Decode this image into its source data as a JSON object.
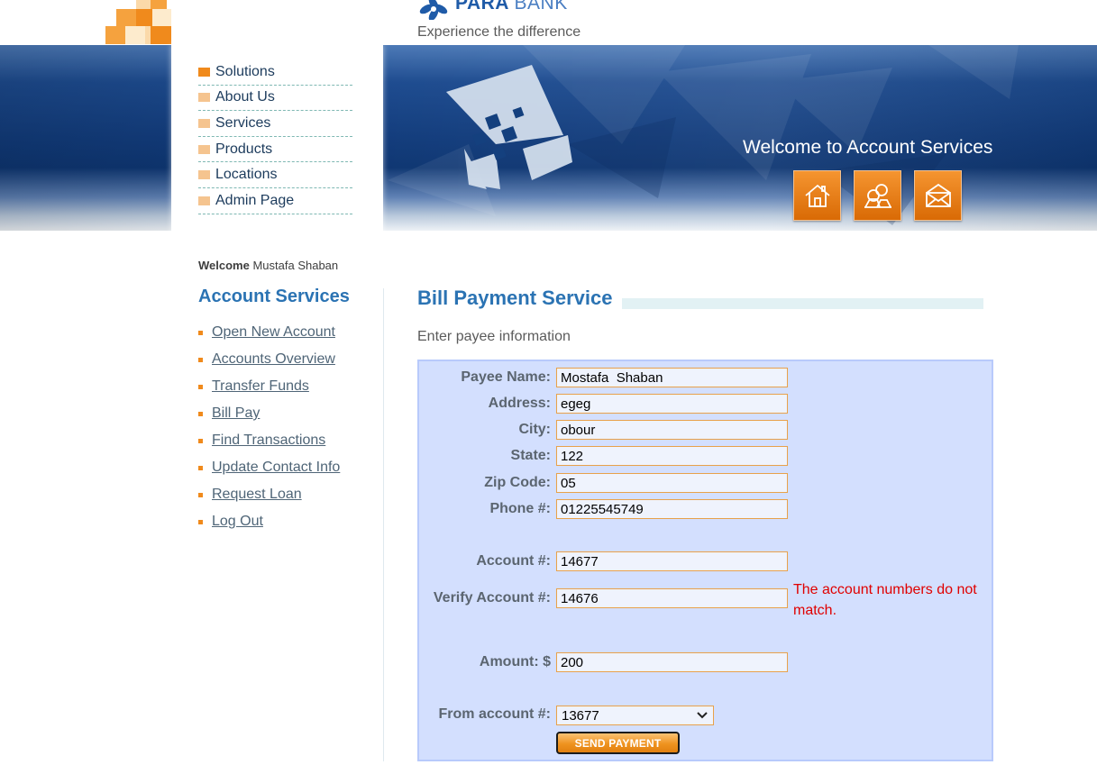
{
  "brand": {
    "name_bold": "PARA",
    "name_thin": "BANK",
    "tagline": "Experience the difference"
  },
  "banner": {
    "welcome_text": "Welcome to Account Services",
    "icons": [
      "home-icon",
      "contact-icon",
      "mail-icon"
    ]
  },
  "top_nav": {
    "items": [
      {
        "label": "Solutions"
      },
      {
        "label": "About Us"
      },
      {
        "label": "Services"
      },
      {
        "label": "Products"
      },
      {
        "label": "Locations"
      },
      {
        "label": "Admin Page"
      }
    ]
  },
  "sidebar": {
    "welcome_label": "Welcome",
    "user_name": "Mustafa Shaban",
    "heading": "Account Services",
    "links": [
      {
        "label": "Open New Account"
      },
      {
        "label": "Accounts Overview"
      },
      {
        "label": "Transfer Funds"
      },
      {
        "label": "Bill Pay"
      },
      {
        "label": "Find Transactions"
      },
      {
        "label": "Update Contact Info"
      },
      {
        "label": "Request Loan"
      },
      {
        "label": "Log Out"
      }
    ]
  },
  "main": {
    "title": "Bill Payment Service",
    "intro": "Enter payee information",
    "form": {
      "payee_name": {
        "label": "Payee Name:",
        "value": "Mostafa  Shaban"
      },
      "address": {
        "label": "Address:",
        "value": "egeg"
      },
      "city": {
        "label": "City:",
        "value": "obour"
      },
      "state": {
        "label": "State:",
        "value": "122"
      },
      "zip": {
        "label": "Zip Code:",
        "value": "05"
      },
      "phone": {
        "label": "Phone #:",
        "value": "01225545749"
      },
      "account": {
        "label": "Account #:",
        "value": "14677"
      },
      "verify_account": {
        "label": "Verify Account #:",
        "value": "14676"
      },
      "verify_error": "The account numbers do not match.",
      "amount": {
        "label": "Amount: $",
        "value": "200"
      },
      "from_account": {
        "label": "From account #:",
        "selected": "13677"
      },
      "send_button": "SEND PAYMENT"
    }
  },
  "colors": {
    "accent_blue": "#2b73b3",
    "accent_orange": "#f08a1c",
    "form_background": "#d3dffe",
    "error_red": "#e00000"
  }
}
